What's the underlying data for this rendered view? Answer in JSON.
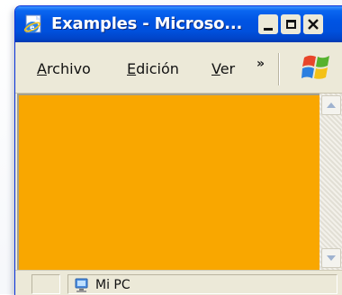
{
  "window": {
    "title": "Examples - Microso...",
    "icon": "ie-page-icon"
  },
  "menubar": {
    "items": [
      {
        "accel": "A",
        "rest": "rchivo"
      },
      {
        "accel": "E",
        "rest": "dición"
      },
      {
        "accel": "V",
        "rest": "er"
      }
    ],
    "overflow": "»",
    "logo": "windows-flag-logo"
  },
  "content": {
    "background": "#f9a700"
  },
  "statusbar": {
    "zone_label": "Mi PC",
    "zone_icon": "my-computer-icon"
  }
}
